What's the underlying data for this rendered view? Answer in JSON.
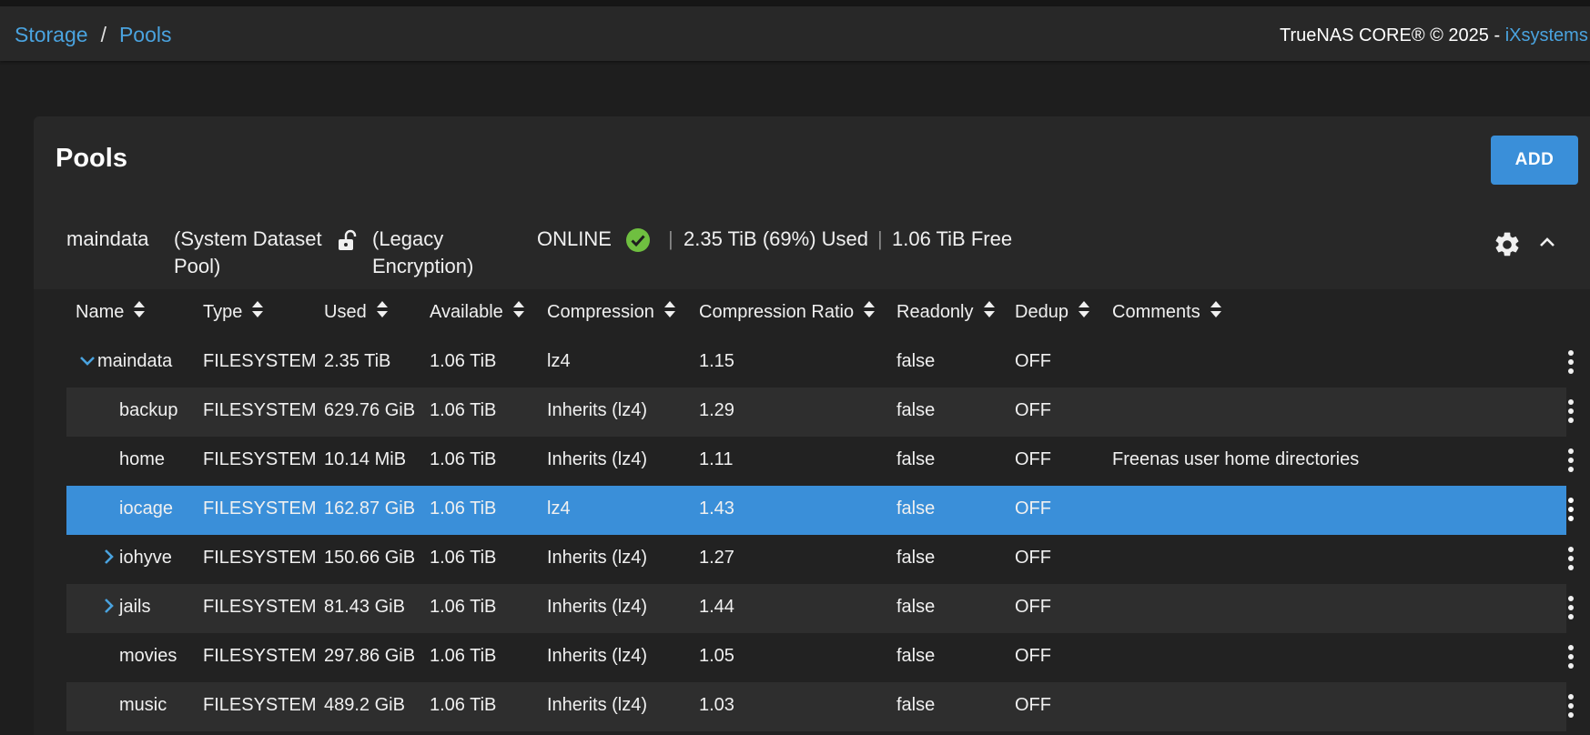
{
  "breadcrumb": {
    "storage": "Storage",
    "separator": "/",
    "pools": "Pools"
  },
  "copyright": {
    "text": "TrueNAS CORE® © 2025 - ",
    "link": "iXsystems"
  },
  "page": {
    "title": "Pools",
    "add_button": "ADD"
  },
  "pool": {
    "name": "maindata",
    "system_dataset": "(System Dataset Pool)",
    "lock_icon": "unlock-icon",
    "encryption": "(Legacy Encryption)",
    "status": "ONLINE",
    "status_icon": "check-circle-icon",
    "status_color": "#6fbf40",
    "separator": "|",
    "used": "2.35 TiB (69%) Used",
    "free": "1.06 TiB Free"
  },
  "table": {
    "columns": [
      "Name",
      "Type",
      "Used",
      "Available",
      "Compression",
      "Compression Ratio",
      "Readonly",
      "Dedup",
      "Comments"
    ],
    "rows": [
      {
        "name": "maindata",
        "type": "FILESYSTEM",
        "used": "2.35 TiB",
        "available": "1.06 TiB",
        "compression": "lz4",
        "ratio": "1.15",
        "readonly": "false",
        "dedup": "OFF",
        "comments": ""
      },
      {
        "name": "backup",
        "type": "FILESYSTEM",
        "used": "629.76 GiB",
        "available": "1.06 TiB",
        "compression": "Inherits (lz4)",
        "ratio": "1.29",
        "readonly": "false",
        "dedup": "OFF",
        "comments": ""
      },
      {
        "name": "home",
        "type": "FILESYSTEM",
        "used": "10.14 MiB",
        "available": "1.06 TiB",
        "compression": "Inherits (lz4)",
        "ratio": "1.11",
        "readonly": "false",
        "dedup": "OFF",
        "comments": "Freenas user home directories"
      },
      {
        "name": "iocage",
        "type": "FILESYSTEM",
        "used": "162.87 GiB",
        "available": "1.06 TiB",
        "compression": "lz4",
        "ratio": "1.43",
        "readonly": "false",
        "dedup": "OFF",
        "comments": ""
      },
      {
        "name": "iohyve",
        "type": "FILESYSTEM",
        "used": "150.66 GiB",
        "available": "1.06 TiB",
        "compression": "Inherits (lz4)",
        "ratio": "1.27",
        "readonly": "false",
        "dedup": "OFF",
        "comments": ""
      },
      {
        "name": "jails",
        "type": "FILESYSTEM",
        "used": "81.43 GiB",
        "available": "1.06 TiB",
        "compression": "Inherits (lz4)",
        "ratio": "1.44",
        "readonly": "false",
        "dedup": "OFF",
        "comments": ""
      },
      {
        "name": "movies",
        "type": "FILESYSTEM",
        "used": "297.86 GiB",
        "available": "1.06 TiB",
        "compression": "Inherits (lz4)",
        "ratio": "1.05",
        "readonly": "false",
        "dedup": "OFF",
        "comments": ""
      },
      {
        "name": "music",
        "type": "FILESYSTEM",
        "used": "489.2 GiB",
        "available": "1.06 TiB",
        "compression": "Inherits (lz4)",
        "ratio": "1.03",
        "readonly": "false",
        "dedup": "OFF",
        "comments": ""
      }
    ]
  },
  "colors": {
    "accent": "#3a8fd9",
    "link": "#4aa3df",
    "selected_row": "#3a8fd9"
  }
}
